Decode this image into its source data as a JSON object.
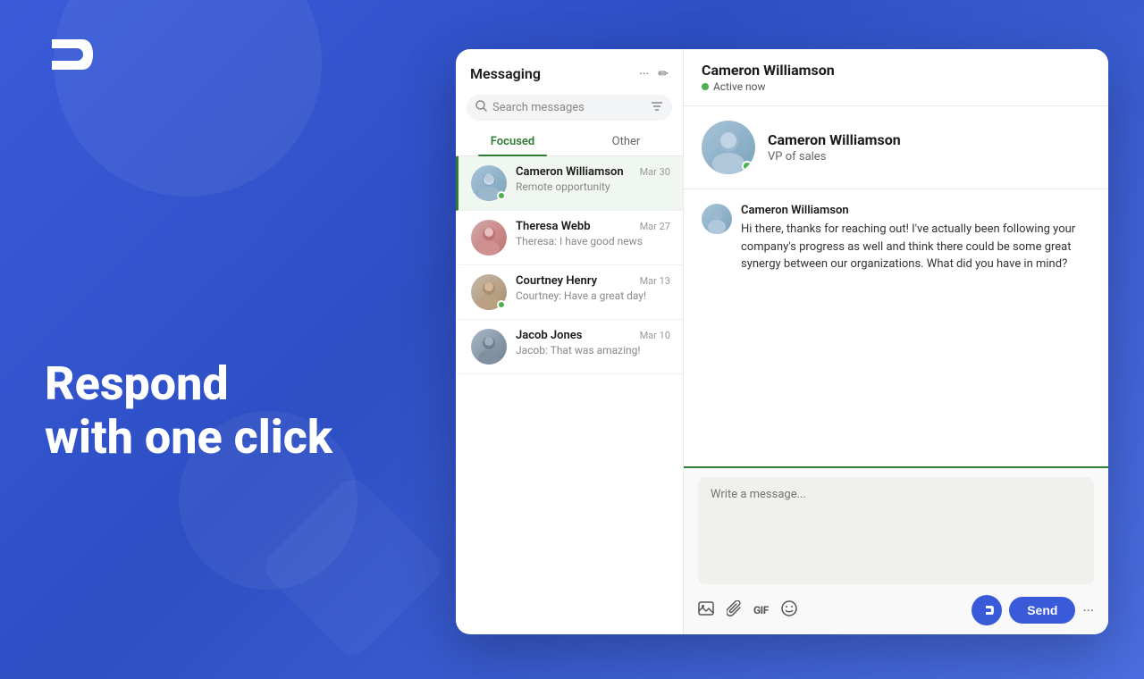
{
  "background": {
    "gradient_start": "#3a5bd9",
    "gradient_end": "#4a6ee0"
  },
  "hero": {
    "logo_symbol": "▷",
    "tagline_line1": "Respond",
    "tagline_line2": "with one click"
  },
  "messaging": {
    "title": "Messaging",
    "header_icons": [
      "···",
      "✏"
    ],
    "search_placeholder": "Search messages",
    "filter_icon": "≡",
    "tabs": [
      {
        "label": "Focused",
        "active": true
      },
      {
        "label": "Other",
        "active": false
      }
    ],
    "conversations": [
      {
        "name": "Cameron Williamson",
        "preview": "Remote opportunity",
        "date": "Mar 30",
        "active": true,
        "online": true,
        "avatar_class": "av-cameron"
      },
      {
        "name": "Theresa Webb",
        "preview": "Theresa: I have good news",
        "date": "Mar 27",
        "active": false,
        "online": false,
        "avatar_class": "av-theresa"
      },
      {
        "name": "Courtney Henry",
        "preview": "Courtney: Have a great day!",
        "date": "Mar 13",
        "active": false,
        "online": false,
        "avatar_class": "av-courtney"
      },
      {
        "name": "Jacob Jones",
        "preview": "Jacob: That was amazing!",
        "date": "Mar 10",
        "active": false,
        "online": false,
        "avatar_class": "av-jacob"
      }
    ]
  },
  "chat": {
    "contact_name": "Cameron Williamson",
    "status": "Active now",
    "profile_name": "Cameron Williamson",
    "profile_title": "VP of sales",
    "message_sender": "Cameron Williamson",
    "message_text": "Hi there, thanks for reaching out! I've actually been following your company's progress as well and think there could be some great synergy between our organizations. What did you have in mind?",
    "input_placeholder": "Write a message...",
    "send_label": "Send",
    "toolbar_icons": [
      "🖼",
      "📎",
      "GIF",
      "😊"
    ],
    "more_options": "···"
  }
}
